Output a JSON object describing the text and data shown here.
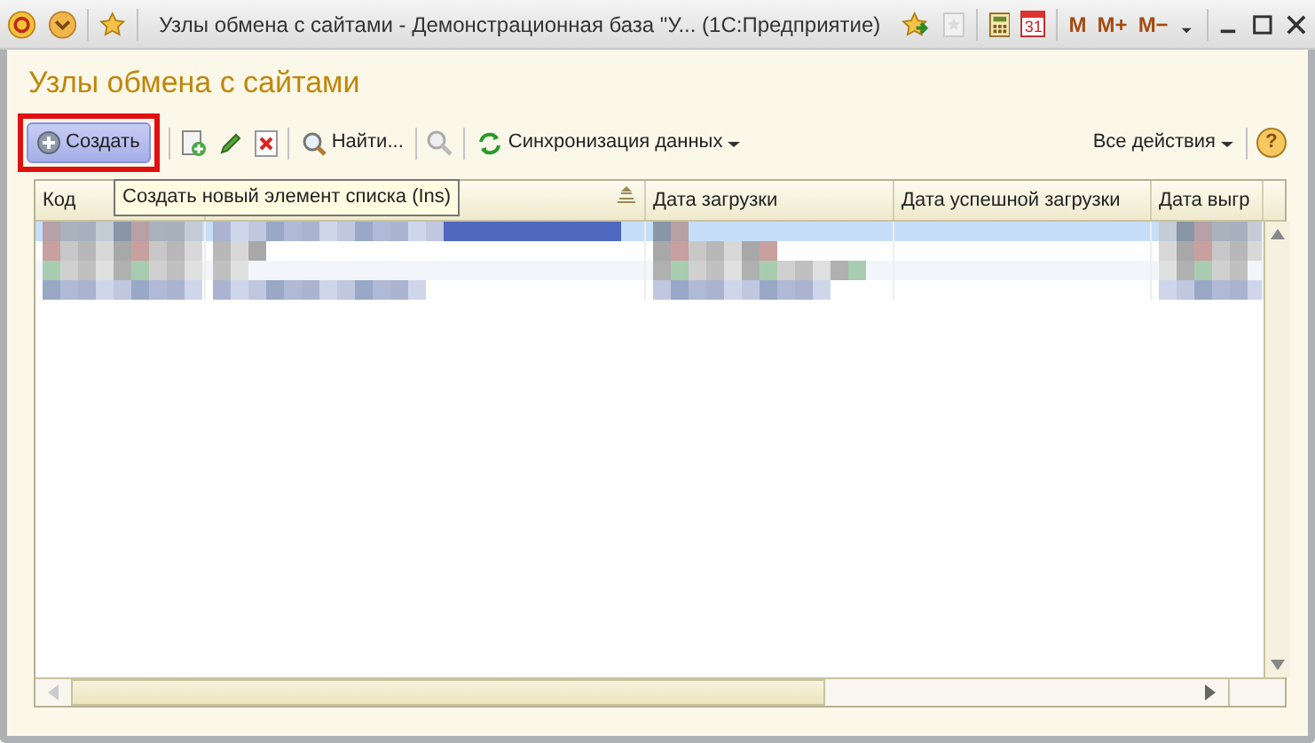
{
  "window": {
    "title": "Узлы обмена с сайтами - Демонстрационная база \"У...  (1С:Предприятие)",
    "calendar_day": "31",
    "memory_buttons": [
      "M",
      "M+",
      "M−"
    ]
  },
  "form": {
    "title": "Узлы обмена с сайтами"
  },
  "toolbar": {
    "create_button": "Создать",
    "highlighted": true,
    "find_button": "Найти...",
    "sync_button": "Синхронизация данных",
    "all_actions": "Все действия",
    "help": "?"
  },
  "tooltip": "Создать новый элемент списка (Ins)",
  "table": {
    "columns": [
      {
        "label": "Код",
        "sorted": false
      },
      {
        "sorted": true
      },
      {
        "label": "Дата загрузки",
        "sorted": false
      },
      {
        "label": "Дата успешной загрузки",
        "sorted": false
      },
      {
        "label": "Дата выгр",
        "sorted": false
      }
    ],
    "rows": [
      {
        "selected": true
      },
      {
        "selected": false
      },
      {
        "selected": false
      },
      {
        "selected": false
      }
    ]
  }
}
